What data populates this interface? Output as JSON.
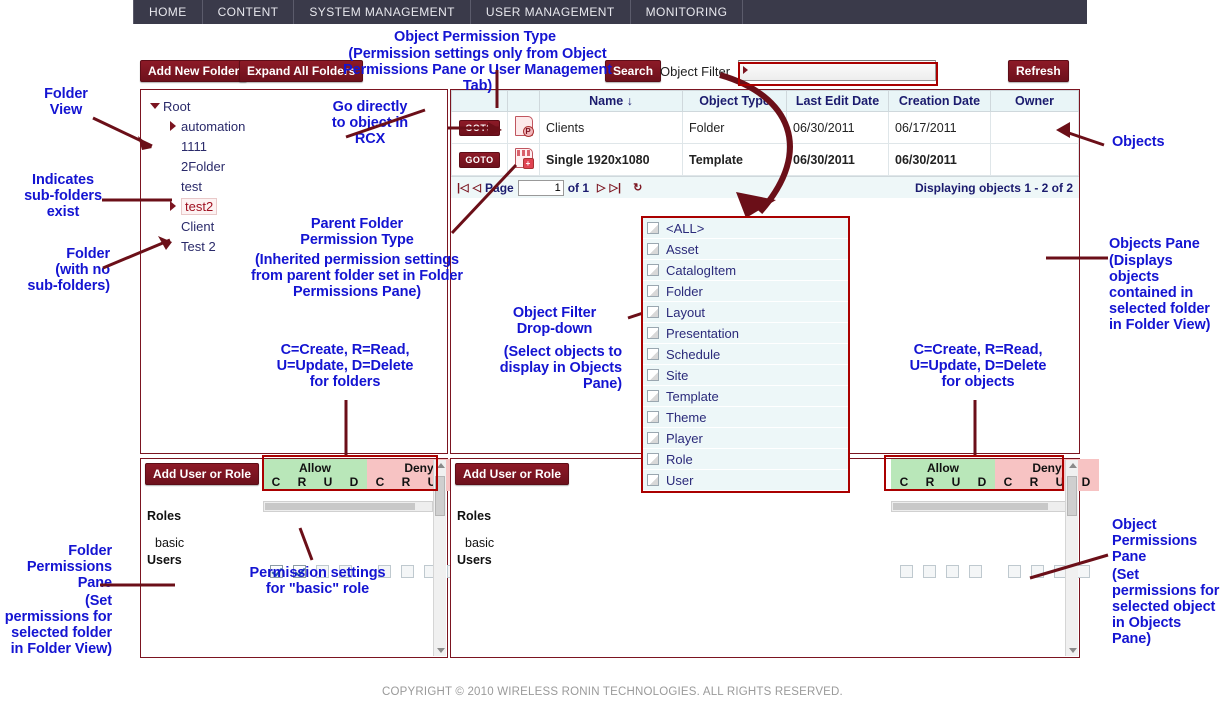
{
  "nav": {
    "items": [
      "HOME",
      "CONTENT",
      "SYSTEM MANAGEMENT",
      "USER MANAGEMENT",
      "MONITORING"
    ]
  },
  "toolbar": {
    "add_new_folder": "Add New Folder",
    "expand_all_folders": "Expand All Folders",
    "search": "Search",
    "object_filter_label": "Object Filter",
    "object_filter_value": "",
    "refresh": "Refresh"
  },
  "folder_tree": [
    {
      "label": "Root",
      "indent": 0,
      "toggle": "down",
      "selected": false
    },
    {
      "label": "automation",
      "indent": 1,
      "toggle": "right",
      "selected": false
    },
    {
      "label": "1111",
      "indent": 1,
      "toggle": "none",
      "selected": false
    },
    {
      "label": "2Folder",
      "indent": 1,
      "toggle": "none",
      "selected": false
    },
    {
      "label": "test",
      "indent": 1,
      "toggle": "none",
      "selected": false
    },
    {
      "label": "test2",
      "indent": 1,
      "toggle": "right",
      "selected": true
    },
    {
      "label": "Client",
      "indent": 1,
      "toggle": "none",
      "selected": false
    },
    {
      "label": "Test 2",
      "indent": 1,
      "toggle": "none",
      "selected": false
    }
  ],
  "objects_table": {
    "columns": [
      "Name ↓",
      "Object Type",
      "Last Edit Date",
      "Creation Date",
      "Owner"
    ],
    "rows": [
      {
        "goto": "GOTO",
        "icon": "page-permission-icon",
        "name": "Clients",
        "type": "Folder",
        "last_edit": "06/30/2011",
        "created": "06/17/2011",
        "owner": "",
        "bold": false
      },
      {
        "goto": "GOTO",
        "icon": "template-icon",
        "name": "Single 1920x1080",
        "type": "Template",
        "last_edit": "06/30/2011",
        "created": "06/30/2011",
        "owner": "",
        "bold": true
      }
    ],
    "pager": {
      "page_label": "Page",
      "page_value": "1",
      "of_label": "of 1",
      "status": "Displaying objects 1 - 2 of 2"
    }
  },
  "object_filter_dropdown": {
    "options": [
      "<ALL>",
      "Asset",
      "CatalogItem",
      "Folder",
      "Layout",
      "Presentation",
      "Schedule",
      "Site",
      "Template",
      "Theme",
      "Player",
      "Role",
      "User"
    ]
  },
  "folder_permissions": {
    "add_button": "Add User or Role",
    "allow_label": "Allow",
    "deny_label": "Deny",
    "crud": [
      "C",
      "R",
      "U",
      "D"
    ],
    "roles_label": "Roles",
    "users_label": "Users",
    "role_name": "basic",
    "allow_checked": [
      true,
      true,
      false,
      false
    ],
    "deny_checked": [
      false,
      false,
      false,
      false
    ]
  },
  "object_permissions": {
    "add_button": "Add User or Role",
    "allow_label": "Allow",
    "deny_label": "Deny",
    "crud": [
      "C",
      "R",
      "U",
      "D"
    ],
    "roles_label": "Roles",
    "users_label": "Users",
    "role_name": "basic",
    "allow_checked": [
      false,
      false,
      false,
      false
    ],
    "deny_checked": [
      false,
      false,
      false,
      false
    ]
  },
  "annotations": {
    "folder_view": "Folder\nView",
    "indicates_subfolders": "Indicates\nsub-folders\nexist",
    "folder_no_sub_title": "Folder",
    "folder_no_sub_sub": "(with no\nsub-folders)",
    "object_permission_type_title": "Object Permission Type",
    "object_permission_type_sub": "(Permission settings only from Object Permissions Pane or User Management Tab)",
    "goto_object": "Go directly\nto object in\nRCX",
    "parent_folder_title": "Parent Folder\nPermission Type",
    "parent_folder_sub": "(Inherited permission settings from parent folder set in Folder Permissions Pane)",
    "crud_folders": "C=Create, R=Read,\nU=Update, D=Delete\nfor folders",
    "crud_objects": "C=Create, R=Read,\nU=Update, D=Delete\nfor objects",
    "object_filter_title": "Object Filter\nDrop-down",
    "object_filter_sub": "(Select objects to display in Objects Pane)",
    "permission_settings_basic": "Permission settings\nfor \"basic\" role",
    "objects": "Objects",
    "objects_pane_title": "Objects Pane",
    "objects_pane_sub": "(Displays objects contained in selected folder in Folder View)",
    "folder_permissions_pane_title": "Folder\nPermissions\nPane",
    "folder_permissions_pane_sub": "(Set permissions for selected folder in Folder View)",
    "object_permissions_pane_title": "Object\nPermissions\nPane",
    "object_permissions_pane_sub": "(Set permissions for selected object in Objects Pane)"
  },
  "footer": "COPYRIGHT © 2010 WIRELESS RONIN TECHNOLOGIES. ALL RIGHTS RESERVED.",
  "colors": {
    "brand_dark_red": "#7b1420",
    "annotation_blue": "#1414d2",
    "allow_green": "#b9e7b9",
    "deny_red": "#f7c3c3",
    "nav_bg": "#3a3a4a"
  }
}
